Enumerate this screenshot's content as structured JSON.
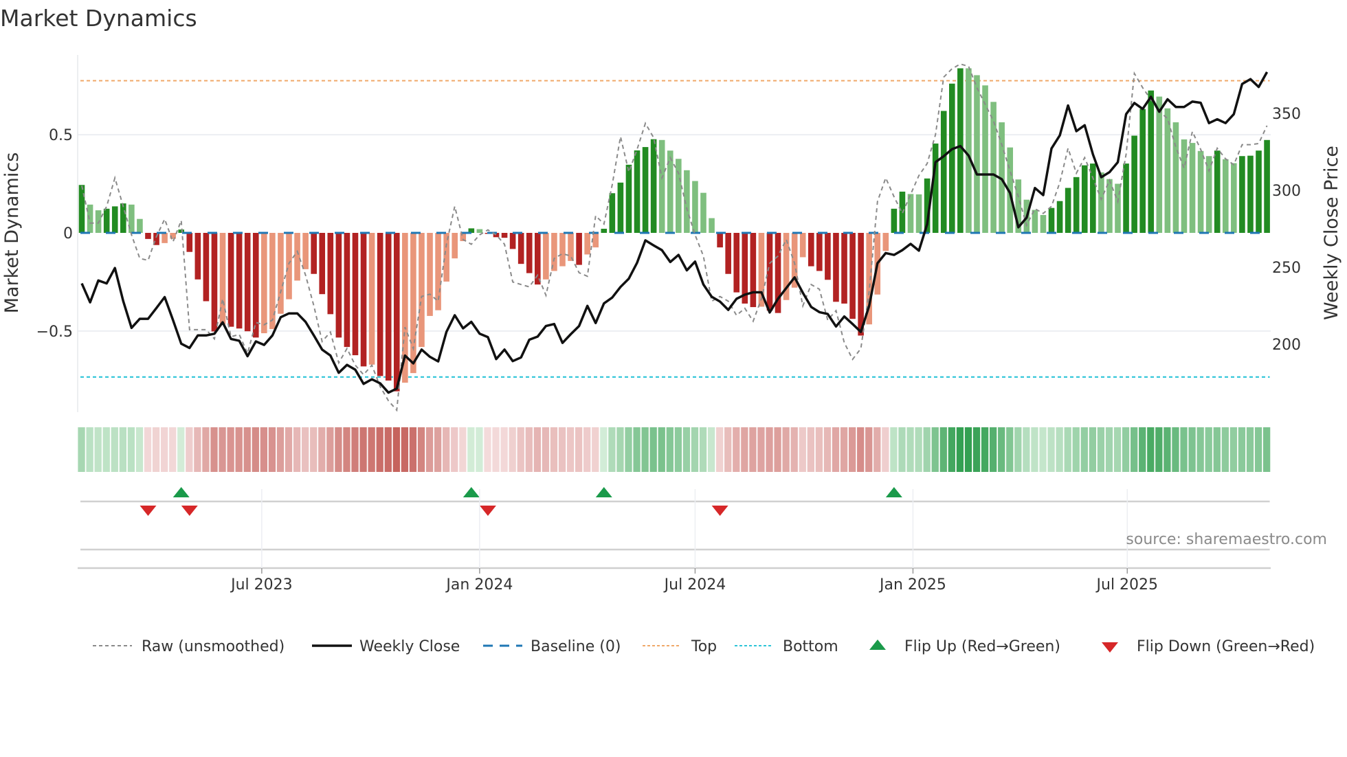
{
  "title": "Market Dynamics",
  "source": "source: sharemaestro.com",
  "legend": {
    "raw": "Raw (unsmoothed)",
    "close": "Weekly Close",
    "baseline": "Baseline (0)",
    "top": "Top",
    "bottom": "Bottom",
    "flip_up": "Flip Up (Red→Green)",
    "flip_down": "Flip Down (Green→Red)"
  },
  "colors": {
    "pos_strong": "#228b22",
    "pos_fade": "#7fbf7f",
    "neg_strong": "#b22222",
    "neg_fade": "#e9967a",
    "raw": "#8a8a8a",
    "close": "#111111",
    "baseline": "#1f77b4",
    "top": "#f0a868",
    "bottom": "#2cc4d8",
    "flip_up": "#1a9a4a",
    "flip_down": "#d62728"
  },
  "chart_data": {
    "type": "bar",
    "title": "Market Dynamics",
    "ylabel": "Market Dynamics",
    "y2label": "Weekly Close Price",
    "start_date": "2023-01-30",
    "interval_days": 7,
    "ylim": [
      -0.913,
      0.906
    ],
    "y2lim": [
      155.8,
      388
    ],
    "yticks": [
      {
        "v": 0.5,
        "label": "0.5"
      },
      {
        "v": 0,
        "label": "0"
      },
      {
        "v": -0.5,
        "label": "−0.5"
      }
    ],
    "y2ticks": [
      {
        "v": 200,
        "label": "200"
      },
      {
        "v": 250,
        "label": "250"
      },
      {
        "v": 300,
        "label": "300"
      },
      {
        "v": 350,
        "label": "350"
      }
    ],
    "xticks": [
      {
        "date": "2023-07-01",
        "label": "Jul 2023"
      },
      {
        "date": "2024-01-01",
        "label": "Jan 2024"
      },
      {
        "date": "2024-07-01",
        "label": "Jul 2024"
      },
      {
        "date": "2025-01-01",
        "label": "Jan 2025"
      },
      {
        "date": "2025-07-01",
        "label": "Jul 2025"
      }
    ],
    "top_level": 0.775,
    "bottom_level": -0.734,
    "baseline": 0,
    "momentum": [
      0.244,
      0.144,
      0.115,
      0.123,
      0.135,
      0.15,
      0.144,
      0.071,
      -0.031,
      -0.062,
      -0.052,
      -0.03,
      0.017,
      -0.097,
      -0.237,
      -0.348,
      -0.502,
      -0.466,
      -0.478,
      -0.487,
      -0.501,
      -0.533,
      -0.511,
      -0.49,
      -0.412,
      -0.338,
      -0.243,
      -0.185,
      -0.209,
      -0.312,
      -0.414,
      -0.533,
      -0.581,
      -0.623,
      -0.68,
      -0.671,
      -0.729,
      -0.752,
      -0.807,
      -0.763,
      -0.714,
      -0.581,
      -0.423,
      -0.394,
      -0.248,
      -0.13,
      -0.042,
      0.023,
      0.019,
      -0.005,
      -0.022,
      -0.025,
      -0.082,
      -0.158,
      -0.205,
      -0.263,
      -0.237,
      -0.194,
      -0.17,
      -0.143,
      -0.163,
      -0.11,
      -0.074,
      0.021,
      0.202,
      0.256,
      0.347,
      0.42,
      0.437,
      0.477,
      0.473,
      0.419,
      0.377,
      0.319,
      0.264,
      0.204,
      0.075,
      -0.074,
      -0.209,
      -0.303,
      -0.36,
      -0.378,
      -0.376,
      -0.396,
      -0.408,
      -0.342,
      -0.279,
      -0.124,
      -0.17,
      -0.194,
      -0.239,
      -0.351,
      -0.36,
      -0.438,
      -0.523,
      -0.466,
      -0.314,
      -0.092,
      0.123,
      0.21,
      0.198,
      0.196,
      0.277,
      0.455,
      0.621,
      0.76,
      0.838,
      0.838,
      0.803,
      0.751,
      0.667,
      0.563,
      0.435,
      0.272,
      0.169,
      0.117,
      0.091,
      0.127,
      0.162,
      0.229,
      0.284,
      0.344,
      0.353,
      0.308,
      0.274,
      0.25,
      0.353,
      0.495,
      0.631,
      0.725,
      0.694,
      0.634,
      0.563,
      0.476,
      0.458,
      0.417,
      0.391,
      0.419,
      0.375,
      0.355,
      0.391,
      0.393,
      0.419,
      0.473
    ],
    "raw": [
      0.24,
      0.05,
      0.05,
      0.135,
      0.28,
      0.135,
      -0.01,
      -0.13,
      -0.14,
      -0.02,
      0.07,
      -0.046,
      0.063,
      -0.493,
      -0.493,
      -0.493,
      -0.54,
      -0.336,
      -0.529,
      -0.517,
      -0.614,
      -0.456,
      -0.468,
      -0.444,
      -0.3,
      -0.155,
      -0.094,
      -0.215,
      -0.372,
      -0.553,
      -0.505,
      -0.662,
      -0.589,
      -0.674,
      -0.722,
      -0.674,
      -0.783,
      -0.855,
      -0.903,
      -0.48,
      -0.589,
      -0.324,
      -0.312,
      -0.348,
      -0.058,
      0.135,
      -0.034,
      -0.058,
      -0.01,
      0.015,
      -0.01,
      -0.058,
      -0.25,
      -0.263,
      -0.275,
      -0.215,
      -0.318,
      -0.13,
      -0.106,
      -0.118,
      -0.203,
      -0.221,
      0.087,
      0.045,
      0.244,
      0.49,
      0.31,
      0.425,
      0.558,
      0.485,
      0.28,
      0.383,
      0.304,
      0.123,
      -0.01,
      -0.118,
      -0.348,
      -0.324,
      -0.348,
      -0.42,
      -0.384,
      -0.45,
      -0.336,
      -0.155,
      -0.118,
      -0.034,
      -0.155,
      -0.372,
      -0.263,
      -0.287,
      -0.444,
      -0.396,
      -0.559,
      -0.644,
      -0.589,
      -0.3,
      0.16,
      0.28,
      0.184,
      0.099,
      0.196,
      0.292,
      0.353,
      0.5,
      0.793,
      0.836,
      0.86,
      0.848,
      0.739,
      0.655,
      0.57,
      0.449,
      0.316,
      0.184,
      0.039,
      0.123,
      0.099,
      0.135,
      0.256,
      0.431,
      0.304,
      0.383,
      0.28,
      0.171,
      0.268,
      0.159,
      0.401,
      0.812,
      0.739,
      0.679,
      0.618,
      0.582,
      0.437,
      0.329,
      0.516,
      0.425,
      0.316,
      0.431,
      0.377,
      0.347,
      0.449,
      0.449,
      0.455,
      0.546
    ],
    "close": [
      239.5,
      227.2,
      241.4,
      239.5,
      249.5,
      228,
      210.6,
      216.5,
      216.5,
      223.4,
      230.6,
      215.7,
      200.3,
      197.5,
      205.7,
      205.7,
      206.8,
      214.2,
      203.4,
      202.2,
      192.2,
      201.8,
      199.5,
      205.7,
      217.5,
      220,
      220,
      214.5,
      205.7,
      196.5,
      192.6,
      181.4,
      186.5,
      183.4,
      174.2,
      177.2,
      174.5,
      168.5,
      171.1,
      192.6,
      187.5,
      196.5,
      191.8,
      188.8,
      208,
      218.8,
      210.3,
      214.5,
      206.8,
      204.6,
      190.3,
      196.5,
      189,
      191.4,
      202.9,
      204.9,
      211.8,
      213.1,
      200.8,
      206.5,
      211.8,
      224.9,
      213.7,
      226.5,
      230.3,
      237.2,
      242.6,
      252.9,
      267.5,
      264.2,
      261.1,
      253.4,
      258,
      248,
      253.7,
      238.8,
      230.8,
      227.7,
      222.3,
      229.5,
      232.2,
      233.7,
      233.7,
      220.6,
      229.5,
      236.5,
      243.4,
      233.4,
      224.2,
      220.8,
      219.6,
      211.5,
      218,
      213.1,
      208,
      224.9,
      252.6,
      259.2,
      258,
      261.1,
      265.2,
      260.8,
      278,
      318.3,
      322.2,
      326.8,
      328.8,
      322.6,
      310.3,
      310.3,
      310.3,
      307.2,
      298.3,
      276,
      282.2,
      301.5,
      296.9,
      327.2,
      335.7,
      355.2,
      338.5,
      342.3,
      323.4,
      308.5,
      311.8,
      318.3,
      349.5,
      356.8,
      352.9,
      360.8,
      351.1,
      359.2,
      354.2,
      354.2,
      357.7,
      356.9,
      343.7,
      346.2,
      343.7,
      349.5,
      369.1,
      372.3,
      367.2,
      376.9
    ],
    "flip_up_index": [
      12,
      47,
      63,
      98
    ],
    "flip_down_index": [
      8,
      13,
      49,
      77
    ]
  }
}
